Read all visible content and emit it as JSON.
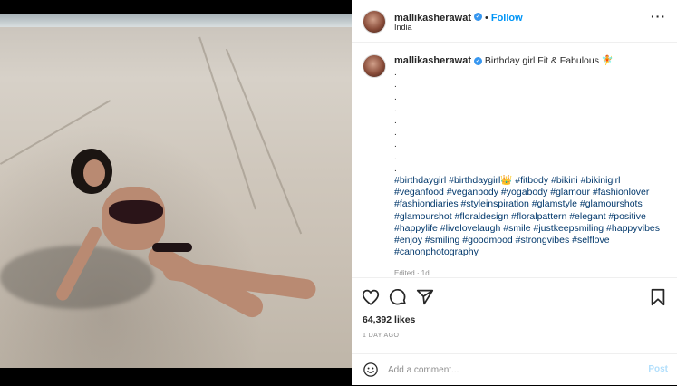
{
  "header": {
    "username": "mallikasherawat",
    "separator": "•",
    "follow_label": "Follow",
    "location": "India",
    "more_icon": "more-options-icon"
  },
  "caption": {
    "username": "mallikasherawat",
    "text": "Birthday girl Fit & Fabulous 🧚",
    "dots": [
      ".",
      ".",
      ".",
      ".",
      ".",
      ".",
      ".",
      ".",
      "."
    ],
    "hashtags": "#birthdaygirl #birthdaygirl👑 #fitbody #bikini #bikinigirl #veganfood #veganbody #yogabody #glamour #fashionlover #fashiondiaries #styleinspiration #glamstyle #glamourshots #glamourshot #floraldesign #floralpattern #elegant #positive #happylife #livelovelaugh #smile #justkeepsmiling #happyvibes #enjoy #smiling #goodmood #strongvibes #selflove #canonphotography",
    "edited": "Edited · 1d"
  },
  "actions": {
    "likes": "64,392 likes",
    "time_ago": "1 DAY AGO"
  },
  "comment": {
    "placeholder": "Add a comment...",
    "post_label": "Post"
  },
  "colors": {
    "link": "#00376b",
    "follow": "#0095f6",
    "verified": "#3797f0",
    "muted": "#8e8e8e"
  }
}
